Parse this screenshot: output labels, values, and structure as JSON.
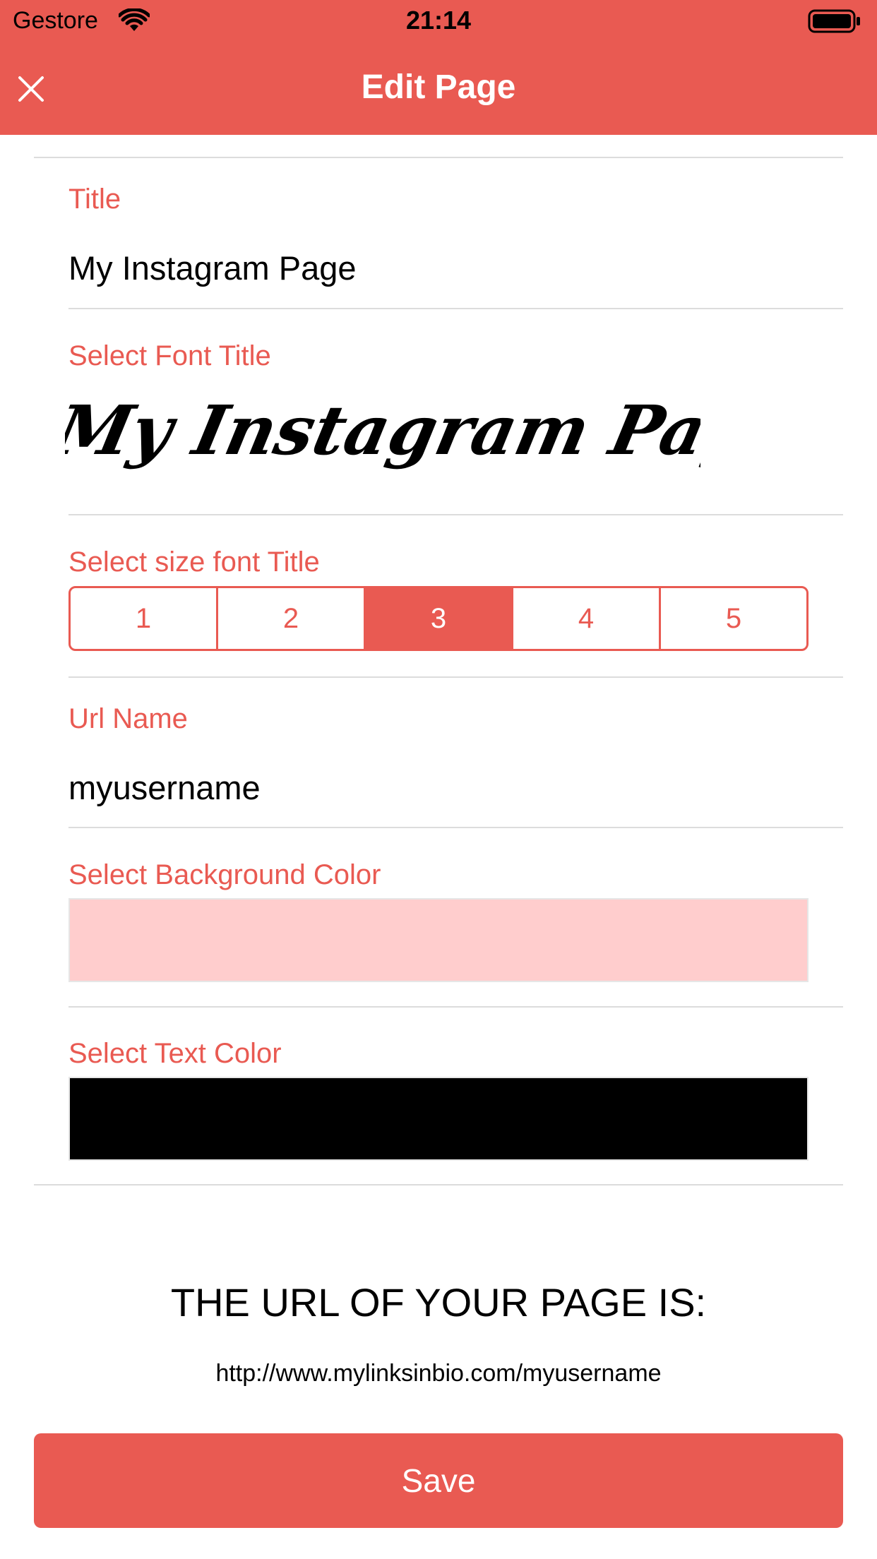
{
  "status_bar": {
    "carrier": "Gestore",
    "time": "21:14"
  },
  "nav": {
    "title": "Edit Page",
    "close_icon": "close-icon"
  },
  "form": {
    "title_label": "Title",
    "title_value": "My Instagram Page",
    "font_label": "Select Font Title",
    "font_preview": "My Instagram Page",
    "size_label": "Select size font Title",
    "size_options": [
      "1",
      "2",
      "3",
      "4",
      "5"
    ],
    "size_selected": "3",
    "url_label": "Url Name",
    "url_value": "myusername",
    "bg_color_label": "Select Background Color",
    "bg_color": "#FFCDCD",
    "text_color_label": "Select Text Color",
    "text_color": "#000000"
  },
  "url_info": {
    "heading": "THE URL OF YOUR PAGE IS:",
    "url": "http://www.mylinksinbio.com/myusername"
  },
  "actions": {
    "save_label": "Save"
  },
  "colors": {
    "accent": "#E95A52",
    "separator": "#DCDCDC"
  }
}
